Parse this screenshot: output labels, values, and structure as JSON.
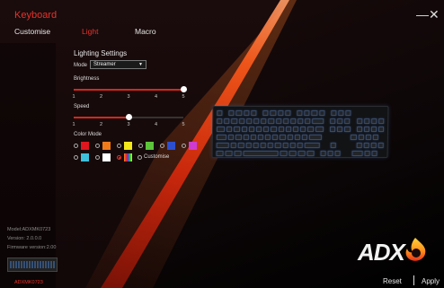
{
  "header": {
    "title": "Keyboard",
    "minimize_glyph": "—",
    "close_glyph": "✕"
  },
  "tabs": [
    {
      "label": "Customise",
      "active": false
    },
    {
      "label": "Light",
      "active": true
    },
    {
      "label": "Macro",
      "active": false
    }
  ],
  "lighting": {
    "title": "Lighting Settings",
    "mode_label": "Mode",
    "mode_value": "Streamer",
    "brightness_label": "Brightness",
    "brightness_value": 5,
    "brightness_ticks": [
      "1",
      "2",
      "3",
      "4",
      "5"
    ],
    "speed_label": "Speed",
    "speed_value": 3,
    "speed_ticks": [
      "1",
      "2",
      "3",
      "4",
      "5"
    ],
    "color_mode_label": "Color Mode",
    "colors": [
      {
        "name": "red",
        "hex": "#e0161e",
        "selected": false
      },
      {
        "name": "orange",
        "hex": "#f07a1a",
        "selected": false
      },
      {
        "name": "yellow",
        "hex": "#f2e81a",
        "selected": false
      },
      {
        "name": "green",
        "hex": "#5cc43a",
        "selected": false
      },
      {
        "name": "blue",
        "hex": "#2d4fcf",
        "selected": false
      },
      {
        "name": "magenta",
        "hex": "#cf3bd0",
        "selected": false
      },
      {
        "name": "cyan",
        "hex": "#3fc0da",
        "selected": false
      },
      {
        "name": "white",
        "hex": "#ffffff",
        "selected": false
      },
      {
        "name": "rainbow",
        "hex": "rainbow",
        "selected": true
      }
    ],
    "customise_label": "Customise"
  },
  "device": {
    "model": "Model:ADXMK0723",
    "version": "Version: 2.0.0.0",
    "firmware": "Firmware version:2.00",
    "name": "ADXMK0723"
  },
  "logo": {
    "text": "ADX",
    "icon": "flame-logo-icon"
  },
  "footer": {
    "reset_label": "Reset",
    "apply_label": "Apply"
  },
  "colors": {
    "accent": "#e8322a",
    "beam": "#ff5a1a"
  }
}
